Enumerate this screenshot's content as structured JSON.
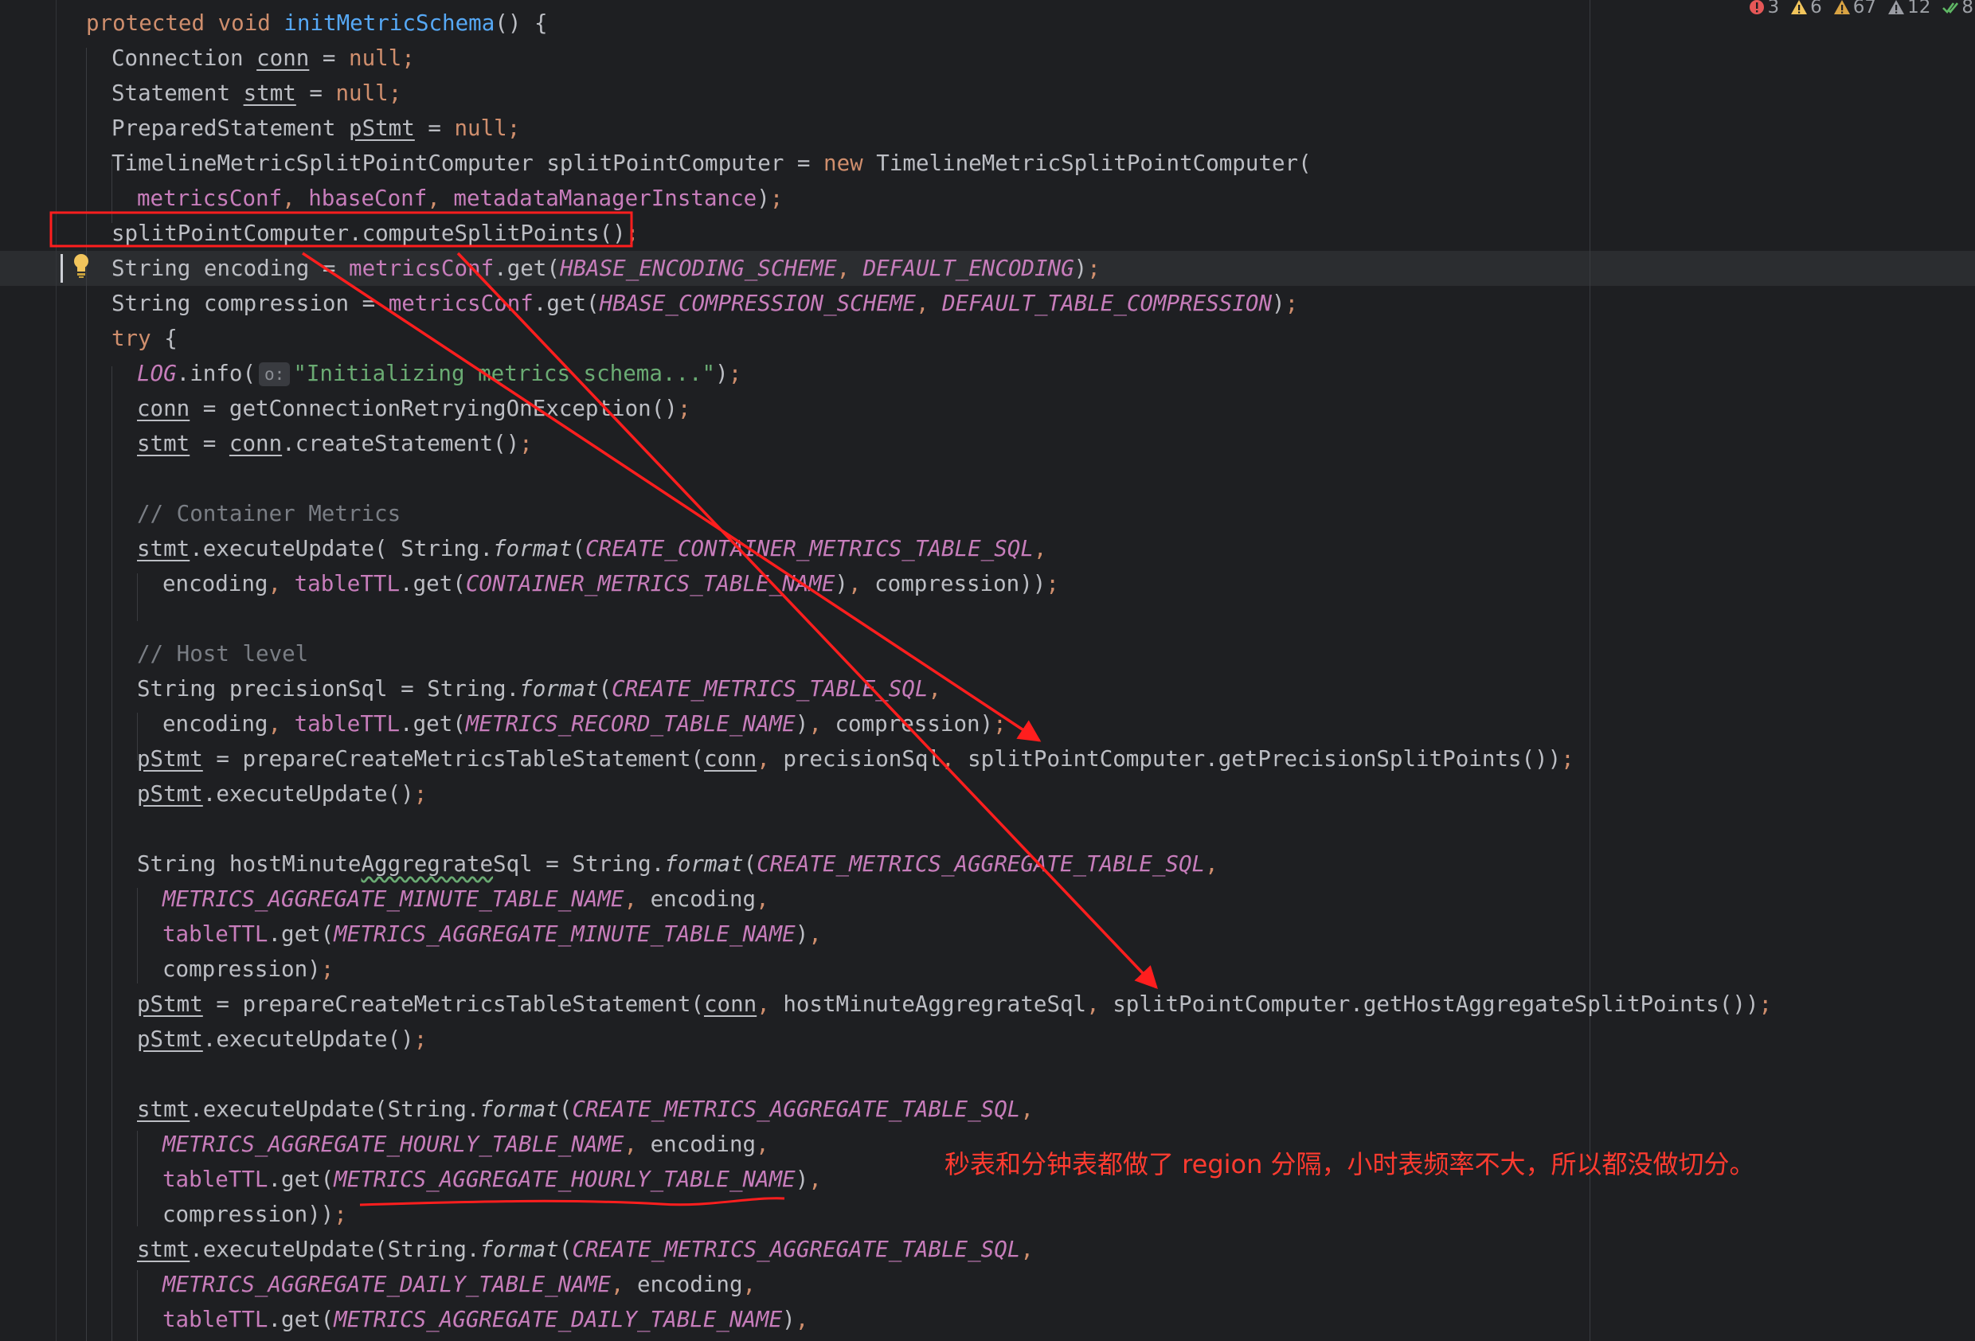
{
  "inspections": {
    "errors": "3",
    "warnings": "6",
    "weak_warnings": "67",
    "typos": "12",
    "ok": "8"
  },
  "code_lines": [
    {
      "indent": 0,
      "tokens": [
        [
          "kw",
          "protected "
        ],
        [
          "kw",
          "void "
        ],
        [
          "fn",
          "initMetricSchema"
        ],
        [
          "",
          "() {"
        ]
      ]
    },
    {
      "indent": 1,
      "tokens": [
        [
          "",
          "Connection "
        ],
        [
          "var",
          "conn"
        ],
        [
          "",
          " = "
        ],
        [
          "kw",
          "null"
        ],
        [
          "kw",
          ";"
        ]
      ]
    },
    {
      "indent": 1,
      "tokens": [
        [
          "",
          "Statement "
        ],
        [
          "var",
          "stmt"
        ],
        [
          "",
          " = "
        ],
        [
          "kw",
          "null"
        ],
        [
          "kw",
          ";"
        ]
      ]
    },
    {
      "indent": 1,
      "tokens": [
        [
          "",
          "PreparedStatement "
        ],
        [
          "var",
          "pStmt"
        ],
        [
          "",
          " = "
        ],
        [
          "kw",
          "null"
        ],
        [
          "kw",
          ";"
        ]
      ]
    },
    {
      "indent": 1,
      "tokens": [
        [
          "",
          "TimelineMetricSplitPointComputer splitPointComputer = "
        ],
        [
          "kw",
          "new "
        ],
        [
          "",
          "TimelineMetricSplitPointComputer("
        ]
      ]
    },
    {
      "indent": 2,
      "tokens": [
        [
          "fld",
          "metricsConf"
        ],
        [
          "kw",
          ", "
        ],
        [
          "fld",
          "hbaseConf"
        ],
        [
          "kw",
          ", "
        ],
        [
          "fld",
          "metadataManagerInstance"
        ],
        [
          "",
          ")"
        ],
        [
          "kw",
          ";"
        ]
      ]
    },
    {
      "indent": 1,
      "tokens": [
        [
          "",
          "splitPointComputer.computeSplitPoints()"
        ],
        [
          "kw",
          ";"
        ]
      ]
    },
    {
      "indent": 1,
      "tokens": [
        [
          "",
          "String encoding = "
        ],
        [
          "fld",
          "metricsConf"
        ],
        [
          "",
          ".get("
        ],
        [
          "cst",
          "HBASE_ENCODING_SCHEME"
        ],
        [
          "kw",
          ", "
        ],
        [
          "cst",
          "DEFAULT_ENCODING"
        ],
        [
          "",
          ")"
        ],
        [
          "kw",
          ";"
        ]
      ]
    },
    {
      "indent": 1,
      "tokens": [
        [
          "",
          "String compression = "
        ],
        [
          "fld",
          "metricsConf"
        ],
        [
          "",
          ".get("
        ],
        [
          "cst",
          "HBASE_COMPRESSION_SCHEME"
        ],
        [
          "kw",
          ", "
        ],
        [
          "cst",
          "DEFAULT_TABLE_COMPRESSION"
        ],
        [
          "",
          ")"
        ],
        [
          "kw",
          ";"
        ]
      ]
    },
    {
      "indent": 1,
      "tokens": [
        [
          "kw",
          "try "
        ],
        [
          "",
          "{"
        ]
      ]
    },
    {
      "indent": 2,
      "tokens": [
        [
          "cst",
          "LOG"
        ],
        [
          "",
          ".info("
        ],
        [
          "hint",
          "o:"
        ],
        [
          "str",
          "\"Initializing metrics schema...\""
        ],
        [
          "",
          ")"
        ],
        [
          "kw",
          ";"
        ]
      ]
    },
    {
      "indent": 2,
      "tokens": [
        [
          "var",
          "conn"
        ],
        [
          "",
          " = getConnectionRetryingOnException()"
        ],
        [
          "kw",
          ";"
        ]
      ]
    },
    {
      "indent": 2,
      "tokens": [
        [
          "var",
          "stmt"
        ],
        [
          "",
          " = "
        ],
        [
          "var",
          "conn"
        ],
        [
          "",
          ".createStatement()"
        ],
        [
          "kw",
          ";"
        ]
      ]
    },
    {
      "indent": 0,
      "tokens": []
    },
    {
      "indent": 2,
      "tokens": [
        [
          "cmt",
          "// Container Metrics"
        ]
      ]
    },
    {
      "indent": 2,
      "tokens": [
        [
          "var",
          "stmt"
        ],
        [
          "",
          ".executeUpdate( String."
        ],
        [
          "sm",
          "format"
        ],
        [
          "",
          "("
        ],
        [
          "cst",
          "CREATE_CONTAINER_METRICS_TABLE_SQL"
        ],
        [
          "kw",
          ","
        ]
      ]
    },
    {
      "indent": 3,
      "tokens": [
        [
          "",
          "encoding"
        ],
        [
          "kw",
          ", "
        ],
        [
          "fld",
          "tableTTL"
        ],
        [
          "",
          ".get("
        ],
        [
          "cst",
          "CONTAINER_METRICS_TABLE_NAME"
        ],
        [
          "",
          ")"
        ],
        [
          "kw",
          ", "
        ],
        [
          "",
          "compression))"
        ],
        [
          "kw",
          ";"
        ]
      ]
    },
    {
      "indent": 0,
      "tokens": []
    },
    {
      "indent": 2,
      "tokens": [
        [
          "cmt",
          "// Host level"
        ]
      ]
    },
    {
      "indent": 2,
      "tokens": [
        [
          "",
          "String precisionSql = String."
        ],
        [
          "sm",
          "format"
        ],
        [
          "",
          "("
        ],
        [
          "cst",
          "CREATE_METRICS_TABLE_SQL"
        ],
        [
          "kw",
          ","
        ]
      ]
    },
    {
      "indent": 3,
      "tokens": [
        [
          "",
          "encoding"
        ],
        [
          "kw",
          ", "
        ],
        [
          "fld",
          "tableTTL"
        ],
        [
          "",
          ".get("
        ],
        [
          "cst",
          "METRICS_RECORD_TABLE_NAME"
        ],
        [
          "",
          ")"
        ],
        [
          "kw",
          ", "
        ],
        [
          "",
          "compression)"
        ],
        [
          "kw",
          ";"
        ]
      ]
    },
    {
      "indent": 2,
      "tokens": [
        [
          "var",
          "pStmt"
        ],
        [
          "",
          " = prepareCreateMetricsTableStatement("
        ],
        [
          "var",
          "conn"
        ],
        [
          "kw",
          ", "
        ],
        [
          "",
          "precisionSql"
        ],
        [
          "kw",
          ", "
        ],
        [
          "",
          "splitPointComputer.getPrecisionSplitPoints())"
        ],
        [
          "kw",
          ";"
        ]
      ]
    },
    {
      "indent": 2,
      "tokens": [
        [
          "var",
          "pStmt"
        ],
        [
          "",
          ".executeUpdate()"
        ],
        [
          "kw",
          ";"
        ]
      ]
    },
    {
      "indent": 0,
      "tokens": []
    },
    {
      "indent": 2,
      "tokens": [
        [
          "",
          "String hostMinute"
        ],
        [
          "wavy",
          "Aggregrate"
        ],
        [
          "",
          "Sql = String."
        ],
        [
          "sm",
          "format"
        ],
        [
          "",
          "("
        ],
        [
          "cst",
          "CREATE_METRICS_AGGREGATE_TABLE_SQL"
        ],
        [
          "kw",
          ","
        ]
      ]
    },
    {
      "indent": 3,
      "tokens": [
        [
          "cst",
          "METRICS_AGGREGATE_MINUTE_TABLE_NAME"
        ],
        [
          "kw",
          ", "
        ],
        [
          "",
          "encoding"
        ],
        [
          "kw",
          ","
        ]
      ]
    },
    {
      "indent": 3,
      "tokens": [
        [
          "fld",
          "tableTTL"
        ],
        [
          "",
          ".get("
        ],
        [
          "cst",
          "METRICS_AGGREGATE_MINUTE_TABLE_NAME"
        ],
        [
          "",
          ")"
        ],
        [
          "kw",
          ","
        ]
      ]
    },
    {
      "indent": 3,
      "tokens": [
        [
          "",
          "compression)"
        ],
        [
          "kw",
          ";"
        ]
      ]
    },
    {
      "indent": 2,
      "tokens": [
        [
          "var",
          "pStmt"
        ],
        [
          "",
          " = prepareCreateMetricsTableStatement("
        ],
        [
          "var",
          "conn"
        ],
        [
          "kw",
          ", "
        ],
        [
          "",
          "hostMinuteAggregrateSql"
        ],
        [
          "kw",
          ", "
        ],
        [
          "",
          "splitPointComputer.getHostAggregateSplitPoints())"
        ],
        [
          "kw",
          ";"
        ]
      ]
    },
    {
      "indent": 2,
      "tokens": [
        [
          "var",
          "pStmt"
        ],
        [
          "",
          ".executeUpdate()"
        ],
        [
          "kw",
          ";"
        ]
      ]
    },
    {
      "indent": 0,
      "tokens": []
    },
    {
      "indent": 2,
      "tokens": [
        [
          "var",
          "stmt"
        ],
        [
          "",
          ".executeUpdate(String."
        ],
        [
          "sm",
          "format"
        ],
        [
          "",
          "("
        ],
        [
          "cst",
          "CREATE_METRICS_AGGREGATE_TABLE_SQL"
        ],
        [
          "kw",
          ","
        ]
      ]
    },
    {
      "indent": 3,
      "tokens": [
        [
          "cst",
          "METRICS_AGGREGATE_HOURLY_TABLE_NAME"
        ],
        [
          "kw",
          ", "
        ],
        [
          "",
          "encoding"
        ],
        [
          "kw",
          ","
        ]
      ]
    },
    {
      "indent": 3,
      "tokens": [
        [
          "fld",
          "tableTTL"
        ],
        [
          "",
          ".get("
        ],
        [
          "cst",
          "METRICS_AGGREGATE_HOURLY_TABLE_NAME"
        ],
        [
          "",
          ")"
        ],
        [
          "kw",
          ","
        ]
      ]
    },
    {
      "indent": 3,
      "tokens": [
        [
          "",
          "compression))"
        ],
        [
          "kw",
          ";"
        ]
      ]
    },
    {
      "indent": 2,
      "tokens": [
        [
          "var",
          "stmt"
        ],
        [
          "",
          ".executeUpdate(String."
        ],
        [
          "sm",
          "format"
        ],
        [
          "",
          "("
        ],
        [
          "cst",
          "CREATE_METRICS_AGGREGATE_TABLE_SQL"
        ],
        [
          "kw",
          ","
        ]
      ]
    },
    {
      "indent": 3,
      "tokens": [
        [
          "cst",
          "METRICS_AGGREGATE_DAILY_TABLE_NAME"
        ],
        [
          "kw",
          ", "
        ],
        [
          "",
          "encoding"
        ],
        [
          "kw",
          ","
        ]
      ]
    },
    {
      "indent": 3,
      "tokens": [
        [
          "fld",
          "tableTTL"
        ],
        [
          "",
          ".get("
        ],
        [
          "cst",
          "METRICS_AGGREGATE_DAILY_TABLE_NAME"
        ],
        [
          "",
          ")"
        ],
        [
          "kw",
          ","
        ]
      ]
    }
  ],
  "annotation": {
    "text": "秒表和分钟表都做了 region 分隔，小时表频率不大，所以都没做切分。",
    "color": "#ff3b30"
  },
  "colors": {
    "background": "#1e1f22",
    "keyword": "#cf8e6d",
    "function": "#56a8f5",
    "field": "#c77dbb",
    "string": "#6aab73",
    "comment": "#7a7e85",
    "annotation_red": "#ff3b30"
  }
}
